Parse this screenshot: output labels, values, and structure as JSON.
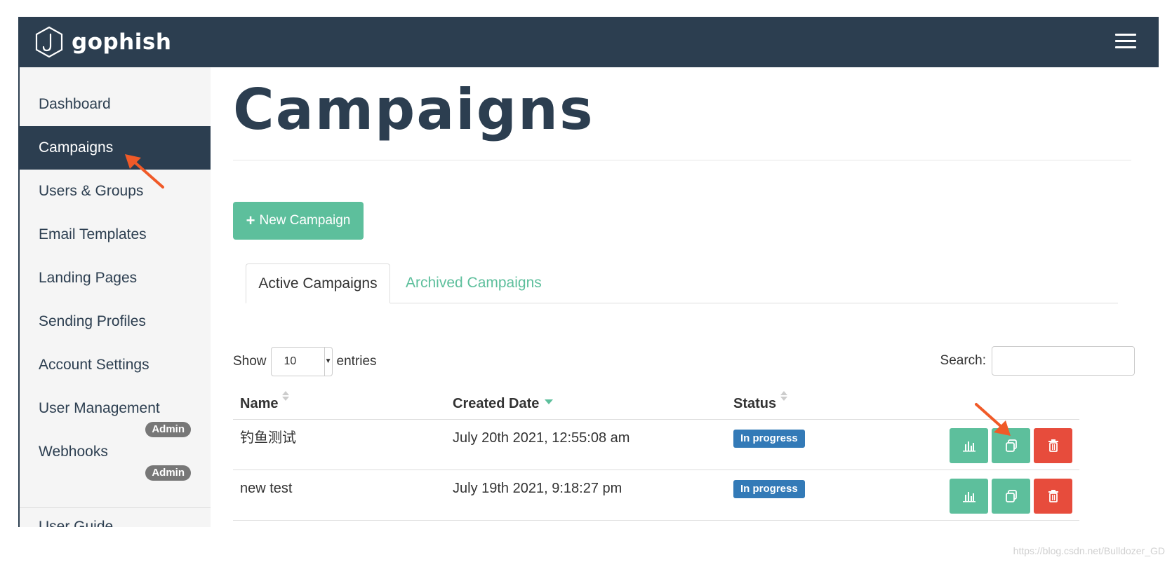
{
  "app": {
    "brand": "gophish",
    "menu_icon": "hamburger-menu-icon",
    "logo_icon": "hook-hexagon-logo"
  },
  "sidebar": {
    "items": [
      {
        "label": "Dashboard"
      },
      {
        "label": "Campaigns",
        "active": true
      },
      {
        "label": "Users & Groups"
      },
      {
        "label": "Email Templates"
      },
      {
        "label": "Landing Pages"
      },
      {
        "label": "Sending Profiles"
      },
      {
        "label": "Account Settings"
      },
      {
        "label": "User Management"
      },
      {
        "label": "Webhooks"
      }
    ],
    "badges": [
      "Admin",
      "Admin"
    ],
    "cut_off_item": "User Guide"
  },
  "main": {
    "title": "Campaigns",
    "new_button_label": "New Campaign",
    "tabs": [
      {
        "label": "Active Campaigns",
        "active": true
      },
      {
        "label": "Archived Campaigns"
      }
    ],
    "show_label": "Show",
    "entries_label": "entries",
    "length_value": "10",
    "search_label": "Search:",
    "search_value": ""
  },
  "table": {
    "columns": [
      "Name",
      "Created Date",
      "Status"
    ],
    "rows": [
      {
        "name": "钓鱼测试",
        "created": "July 20th 2021, 12:55:08 am",
        "status": "In progress"
      },
      {
        "name": "new test",
        "created": "July 19th 2021, 9:18:27 pm",
        "status": "In progress"
      }
    ],
    "action_icons": [
      "bar-chart-icon",
      "copy-icon",
      "trash-icon"
    ]
  },
  "colors": {
    "navbar": "#2c3e50",
    "accent_green": "#5dbf9c",
    "danger_red": "#e74c3c",
    "status_blue": "#337ab7",
    "annotation_arrow": "#f05a28"
  },
  "watermark": "https://blog.csdn.net/Bulldozer_GD"
}
